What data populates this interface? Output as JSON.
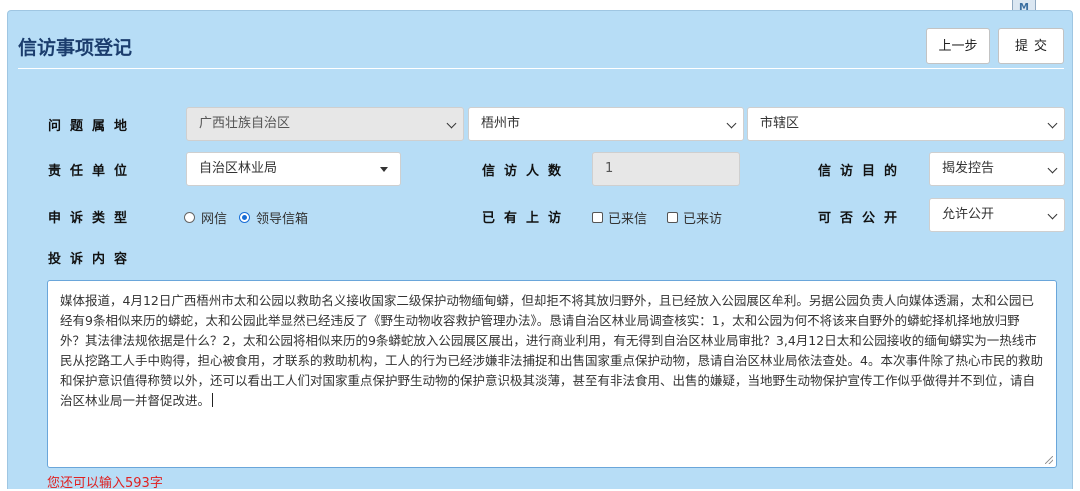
{
  "header": {
    "title": "信访事项登记",
    "prev_label": "上一步",
    "submit_label": "提交",
    "top_icon_glyph": "M"
  },
  "form": {
    "location": {
      "label": "问题属地",
      "province": "广西壮族自治区",
      "city": "梧州市",
      "district": "市辖区"
    },
    "responsible_unit": {
      "label": "责任单位",
      "value": "自治区林业局"
    },
    "petitioner_count": {
      "label": "信访人数",
      "value": "1"
    },
    "petition_purpose": {
      "label": "信访目的",
      "value": "揭发控告"
    },
    "complaint_type": {
      "label": "申诉类型",
      "options": [
        {
          "label": "网信",
          "selected": false
        },
        {
          "label": "领导信箱",
          "selected": true
        }
      ]
    },
    "prior_visits": {
      "label": "已有上访",
      "options": [
        {
          "label": "已来信",
          "checked": false
        },
        {
          "label": "已来访",
          "checked": false
        }
      ]
    },
    "public": {
      "label": "可否公开",
      "value": "允许公开"
    },
    "content": {
      "label": "投诉内容",
      "text": "媒体报道，4月12日广西梧州市太和公园以救助名义接收国家二级保护动物缅甸蟒，但却拒不将其放归野外，且已经放入公园展区牟利。另据公园负责人向媒体透漏，太和公园已经有9条相似来历的蟒蛇，太和公园此举显然已经违反了《野生动物收容救护管理办法》。恳请自治区林业局调查核实：1，太和公园为何不将该来自野外的蟒蛇择机择地放归野外？其法律法规依据是什么？2，太和公园将相似来历的9条蟒蛇放入公园展区展出，进行商业利用，有无得到自治区林业局审批？3,4月12日太和公园接收的缅甸蟒实为一热线市民从挖路工人手中购得，担心被食用，才联系的救助机构，工人的行为已经涉嫌非法捕捉和出售国家重点保护动物，恳请自治区林业局依法查处。4。本次事件除了热心市民的救助和保护意识值得称赞以外，还可以看出工人们对国家重点保护野生动物的保护意识极其淡薄，甚至有非法食用、出售的嫌疑，当地野生动物保护宣传工作似乎做得并不到位，请自治区林业局一并督促改进。",
      "remaining_hint": "您还可以输入593字"
    }
  },
  "colors": {
    "panel_bg": "#b7ddf6",
    "title": "#1b3d6d",
    "hint": "#e02020",
    "radio_accent": "#1a6ed6"
  }
}
